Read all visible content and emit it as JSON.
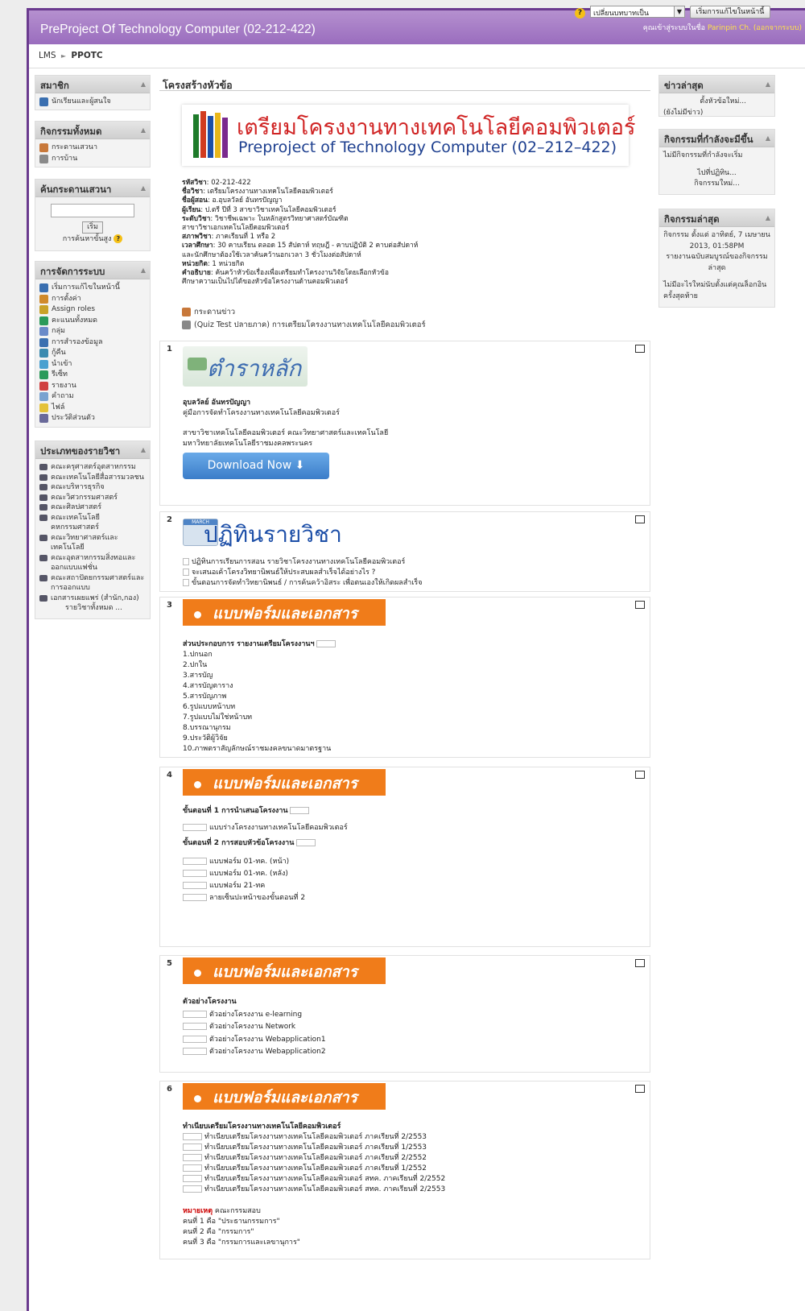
{
  "header": {
    "site_title": "PreProject Of Technology Computer (02-212-422)",
    "login_prefix": "คุณเข้าสู่ระบบในชื่อ",
    "user_name": "Parinpin Ch.",
    "logout": "(ออกจากระบบ)"
  },
  "nav": {
    "home": "LMS",
    "separator": "►",
    "course": "PPOTC",
    "role_select": "เปลี่ยนบทบาทเป็น",
    "edit_button": "เริ่มการแก้ไขในหน้านี้",
    "help": "?"
  },
  "left_blocks": {
    "members": {
      "title": "สมาชิก",
      "items": [
        {
          "label": "นักเรียนและผู้สนใจ",
          "icon": "users-icon"
        }
      ]
    },
    "activities": {
      "title": "กิจกรรมทั้งหมด",
      "items": [
        {
          "label": "กระดานเสวนา",
          "icon": "forum-icon"
        },
        {
          "label": "การบ้าน",
          "icon": "assignment-icon"
        }
      ]
    },
    "search": {
      "title": "ค้นกระดานเสวนา",
      "button": "เริ่ม",
      "advanced": "การค้นหาขั้นสูง",
      "input_value": ""
    },
    "admin": {
      "title": "การจัดการระบบ",
      "items": [
        {
          "label": "เริ่มการแก้ไขในหน้านี้",
          "icon": "edit-icon"
        },
        {
          "label": "การตั้งค่า",
          "icon": "settings-icon"
        },
        {
          "label": "Assign roles",
          "icon": "roles-icon"
        },
        {
          "label": "คะแนนทั้งหมด",
          "icon": "grades-icon"
        },
        {
          "label": "กลุ่ม",
          "icon": "groups-icon"
        },
        {
          "label": "การสำรองข้อมูล",
          "icon": "backup-icon"
        },
        {
          "label": "กู้คืน",
          "icon": "restore-icon"
        },
        {
          "label": "นำเข้า",
          "icon": "import-icon"
        },
        {
          "label": "รีเซ็ท",
          "icon": "reset-icon"
        },
        {
          "label": "รายงาน",
          "icon": "reports-icon"
        },
        {
          "label": "คำถาม",
          "icon": "questions-icon"
        },
        {
          "label": "ไฟล์",
          "icon": "files-icon"
        },
        {
          "label": "ประวัติส่วนตัว",
          "icon": "profile-icon"
        }
      ]
    },
    "categories": {
      "title": "ประเภทของรายวิชา",
      "items": [
        "คณะครุศาสตร์อุตสาหกรรม",
        "คณะเทคโนโลยีสื่อสารมวลชน",
        "คณะบริหารธุรกิจ",
        "คณะวิศวกรรมศาสตร์",
        "คณะศิลปศาสตร์",
        "คณะเทคโนโลยีคหกรรมศาสตร์",
        "คณะวิทยาศาสตร์และ เทคโนโลยี",
        "คณะอุตสาหกรรมสิ่งทอและ ออกแบบแฟชั่น",
        "คณะสถาปัตยกรรมศาสตร์และ การออกแบบ",
        "เอกสารเผยแพร่ (สำนัก,กอง)"
      ],
      "all_link": "รายวิชาทั้งหมด ..."
    }
  },
  "right_blocks": {
    "news": {
      "title": "ข่าวล่าสุด",
      "add": "ตั้งหัวข้อใหม่...",
      "empty": "(ยังไม่มีข่าว)"
    },
    "upcoming": {
      "title": "กิจกรรมที่กำลังจะมีขึ้น",
      "empty": "ไม่มีกิจกรรมที่กำลังจะเริ่ม",
      "calendar": "ไปที่ปฏิทิน...",
      "new_event": "กิจกรรมใหม่..."
    },
    "recent": {
      "title": "กิจกรรมล่าสุด",
      "since": "กิจกรรม ตั้งแต่ อาทิตย์, 7 เมษายน 2013, 01:58PM",
      "report": "รายงานฉบับสมบูรณ์ของกิจกรรมล่าสุด",
      "nothing": "ไม่มีอะไรใหม่นับตั้งแต่คุณล็อกอินครั้งสุดท้าย"
    }
  },
  "main": {
    "title": "โครงสร้างหัวข้อ",
    "banner": {
      "thai": "เตรียมโครงงานทางเทคโนโลยีคอมพิวเตอร์",
      "english": "Preproject of Technology Computer (02–212–422)"
    },
    "info": [
      {
        "k": "รหัสวิชา",
        "v": ": 02-212-422"
      },
      {
        "k": "ชื่อวิชา",
        "v": ": เตรียมโครงงานทางเทคโนโลยีคอมพิวเตอร์"
      },
      {
        "k": "ชื่อผู้สอน",
        "v": ": อ.อุบลวัลย์ อันทรปัญญา"
      },
      {
        "k": "ผู้เรียน",
        "v": ": ป.ตรี ปีที่ 3 สาขาวิชาเทคโนโลยีคอมพิวเตอร์"
      },
      {
        "k": "ระดับวิชา",
        "v": ": วิชาชีพเฉพาะ ในหลักสูตรวิทยาศาสตร์บัณฑิต"
      },
      {
        "k": "",
        "v": "สาขาวิชาเอกเทคโนโลยีคอมพิวเตอร์"
      },
      {
        "k": "สภาพวิชา",
        "v": ": ภาคเรียนที่ 1 หรือ 2"
      },
      {
        "k": "เวลาศึกษา",
        "v": ": 30 คาบเรียน ตลอด 15 สัปดาห์ ทฤษฎี - คาบปฏิบัติ 2 คาบต่อสัปดาห์"
      },
      {
        "k": "",
        "v": "และนักศึกษาต้องใช้เวลาค้นคว้านอกเวลา 3 ชั่วโมงต่อสัปดาห์"
      },
      {
        "k": "หน่วยกิต",
        "v": ": 1 หน่วยกิต"
      },
      {
        "k": "คำอธิบาย",
        "v": ": ค้นคว้าหัวข้อเรื่องเพื่อเตรียมทำโครงงานวิจัยโดยเลือกหัวข้อ"
      },
      {
        "k": "",
        "v": "ศึกษาความเป็นไปได้ของหัวข้อโครงงานด้านคอมพิวเตอร์"
      }
    ],
    "links": [
      "กระดานข่าว",
      "(Quiz Test ปลายภาค) การเตรียมโครงงานทางเทคโนโลยีคอมพิวเตอร์"
    ],
    "sections": [
      {
        "num": "1",
        "image_title": "ตำราหลัก",
        "author": "อุบลวัลย์ อันทรปัญญา",
        "book": "คู่มือการจัดทำโครงงานทางเทคโนโลยีคอมพิวเตอร์",
        "dept1": "สาขาวิชาเทคโนโลยีคอมพิวเตอร์ คณะวิทยาศาสตร์และเทคโนโลยี",
        "dept2": "มหาวิทยาลัยเทคโนโลยีราชมงคลพระนคร",
        "download": "Download Now"
      },
      {
        "num": "2",
        "image_title": "ปฏิทินรายวิชา",
        "badge": "MARCH",
        "items": [
          "ปฏิทินการเรียนการสอน รายวิชาโครงงานทางเทคโนโลยีคอมพิวเตอร์",
          "จะเสนอเค้าโครงวิทยานิพนธ์ให้ประสบผลสำเร็จได้อย่างไร ?",
          "ขั้นตอนการจัดทำวิทยานิพนธ์ / การค้นคว้าอิสระ เพื่อตนเองให้เกิดผลสำเร็จ"
        ]
      },
      {
        "num": "3",
        "banner": "แบบฟอร์มและเอกสาร",
        "heading": "ส่วนประกอบการ รายงานเตรียมโครงงานฯ",
        "items": [
          "1.ปกนอก",
          "2.ปกใน",
          "3.สารบัญ",
          "4.สารบัญตาราง",
          "5.สารบัญภาพ",
          "6.รูปแบบหน้าบท",
          "7.รูปแบบไม่ใช่หน้าบท",
          "8.บรรณานุกรม",
          "9.ประวัติผู้วิจัย",
          "10.ภาพตราสัญลักษณ์ราชมงคลขนาดมาตรฐาน"
        ]
      },
      {
        "num": "4",
        "banner": "แบบฟอร์มและเอกสาร",
        "step1": "ขั้นตอนที่ 1 การนำเสนอโครงงาน",
        "step1_items": [
          "แบบร่างโครงงานทางเทคโนโลยีคอมพิวเตอร์"
        ],
        "step2": "ขั้นตอนที่ 2 การสอบหัวข้อโครงงาน",
        "step2_items": [
          "แบบฟอร์ม 01-ทค. (หน้า)",
          "แบบฟอร์ม 01-ทค. (หลัง)",
          "แบบฟอร์ม 21-ทค",
          "ลายเซ็นปะหน้าของขั้นตอนที่ 2"
        ]
      },
      {
        "num": "5",
        "banner": "แบบฟอร์มและเอกสาร",
        "heading": "ตัวอย่างโครงงาน",
        "items": [
          "ตัวอย่างโครงงาน e-learning",
          "ตัวอย่างโครงงาน Network",
          "ตัวอย่างโครงงาน Webapplication1",
          "ตัวอย่างโครงงาน Webapplication2"
        ]
      },
      {
        "num": "6",
        "banner": "แบบฟอร์มและเอกสาร",
        "heading": "ทำเนียบเตรียมโครงงานทางเทคโนโลยีคอมพิวเตอร์",
        "items": [
          "ทำเนียบเตรียมโครงงานทางเทคโนโลยีคอมพิวเตอร์ ภาคเรียนที่ 2/2553",
          "ทำเนียบเตรียมโครงงานทางเทคโนโลยีคอมพิวเตอร์ ภาคเรียนที่ 1/2553",
          "ทำเนียบเตรียมโครงงานทางเทคโนโลยีคอมพิวเตอร์ ภาคเรียนที่ 2/2552",
          "ทำเนียบเตรียมโครงงานทางเทคโนโลยีคอมพิวเตอร์ ภาคเรียนที่ 1/2552",
          "ทำเนียบเตรียมโครงงานทางเทคโนโลยีคอมพิวเตอร์ สทค. ภาคเรียนที่ 2/2552",
          "ทำเนียบเตรียมโครงงานทางเทคโนโลยีคอมพิวเตอร์ สทค. ภาคเรียนที่ 2/2553"
        ],
        "note_label": "หมายเหตุ",
        "note_text": "คณะกรรมสอบ",
        "notes": [
          "คนที่ 1 คือ \"ประธานกรรมการ\"",
          "คนที่ 2 คือ \"กรรมการ\"",
          "คนที่ 3 คือ \"กรรมการและเลขานุการ\""
        ]
      }
    ]
  },
  "colors": {
    "header": "#9a6dbe",
    "accent_orange": "#f07c1a",
    "download_blue": "#4a8fd6",
    "note_red": "#cc0000"
  }
}
